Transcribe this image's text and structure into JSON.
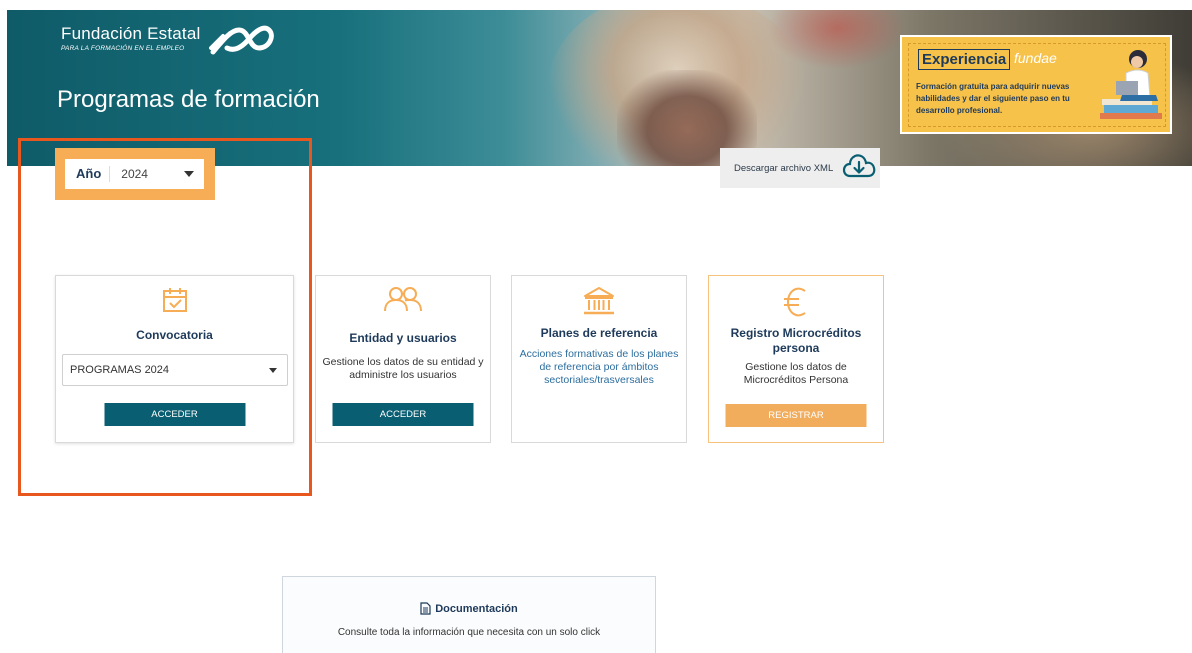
{
  "header": {
    "brand_name": "Fundación Estatal",
    "brand_sub": "PARA LA FORMACIÓN EN EL EMPLEO",
    "page_title": "Programas de formación"
  },
  "promo": {
    "title": "Experiencia",
    "title_alt": "fundae",
    "text": "Formación gratuita para adquirir nuevas habilidades y dar el siguiente paso en tu desarrollo profesional."
  },
  "year_selector": {
    "label": "Año",
    "value": "2024"
  },
  "download": {
    "label": "Descargar archivo XML",
    "icon": "cloud-download-icon"
  },
  "cards": {
    "convocatoria": {
      "icon": "calendar-check-icon",
      "title": "Convocatoria",
      "select_value": "PROGRAMAS 2024",
      "button": "ACCEDER"
    },
    "entidad": {
      "icon": "users-icon",
      "title": "Entidad y usuarios",
      "desc": "Gestione los datos de su entidad y administre los usuarios",
      "button": "ACCEDER"
    },
    "planes": {
      "icon": "institution-icon",
      "title": "Planes de referencia",
      "desc": "Acciones formativas de los planes de referencia por ámbitos sectoriales/trasversales"
    },
    "microcreditos": {
      "icon": "euro-icon",
      "title": "Registro Microcréditos persona",
      "desc": "Gestione los datos de Microcréditos Persona",
      "button": "REGISTRAR"
    }
  },
  "documentation": {
    "icon": "document-icon",
    "title": "Documentación",
    "desc": "Consulte toda la información que necesita con un solo click"
  },
  "colors": {
    "teal": "#0a5e72",
    "orange": "#f6ad55",
    "highlight": "#e8571e",
    "navy": "#1e3a5a"
  }
}
